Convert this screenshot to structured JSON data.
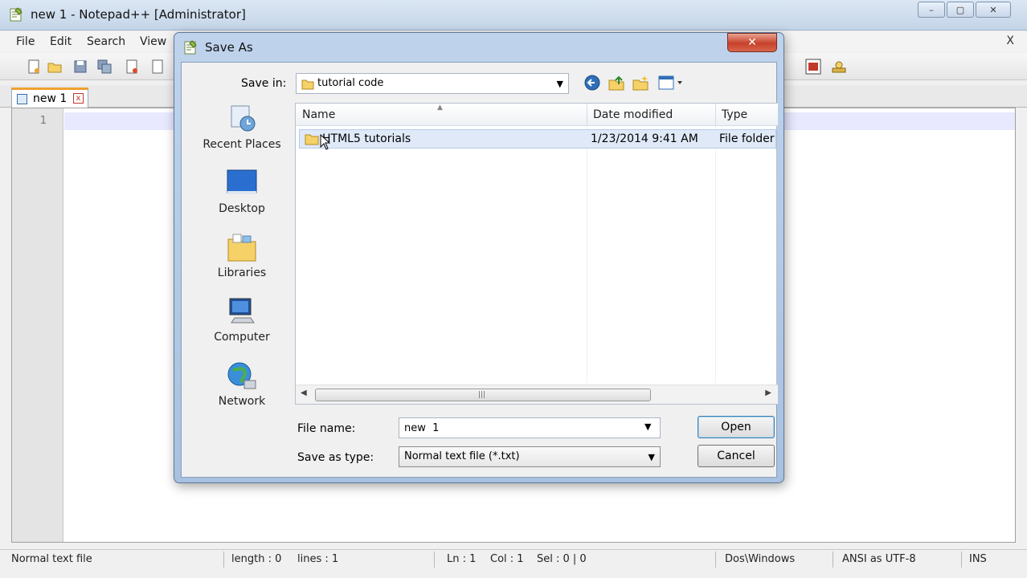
{
  "npp": {
    "title": "new  1 - Notepad++ [Administrator]",
    "window_buttons": [
      "–",
      "▢",
      "✕"
    ],
    "menu": [
      "File",
      "Edit",
      "Search",
      "View"
    ],
    "menu_close": "X",
    "tab": {
      "label": "new  1",
      "close": "x"
    },
    "line_number": "1"
  },
  "status": {
    "type": "Normal text file",
    "length": "length : 0",
    "lines": "lines : 1",
    "ln": "Ln : 1",
    "col": "Col : 1",
    "sel": "Sel : 0 | 0",
    "eol": "Dos\\Windows",
    "encoding": "ANSI as UTF-8",
    "mode": "INS"
  },
  "dialog": {
    "title": "Save As",
    "close_glyph": "✕",
    "save_in_label": "Save in:",
    "save_in_value": "tutorial code",
    "places": [
      "Recent Places",
      "Desktop",
      "Libraries",
      "Computer",
      "Network"
    ],
    "columns": [
      "Name",
      "Date modified",
      "Type"
    ],
    "rows": [
      {
        "name": "HTML5 tutorials",
        "date": "1/23/2014 9:41 AM",
        "type": "File folder"
      }
    ],
    "file_name_label": "File name:",
    "file_name_value": "new  1",
    "save_type_label": "Save as type:",
    "save_type_value": "Normal text file (*.txt)",
    "open_label": "Open",
    "cancel_label": "Cancel"
  },
  "colors": {
    "dialog_frame": "#bfd3ec",
    "close_red": "#c7412a",
    "selection": "#dfe9f8",
    "current_line": "#e8e8ff"
  }
}
